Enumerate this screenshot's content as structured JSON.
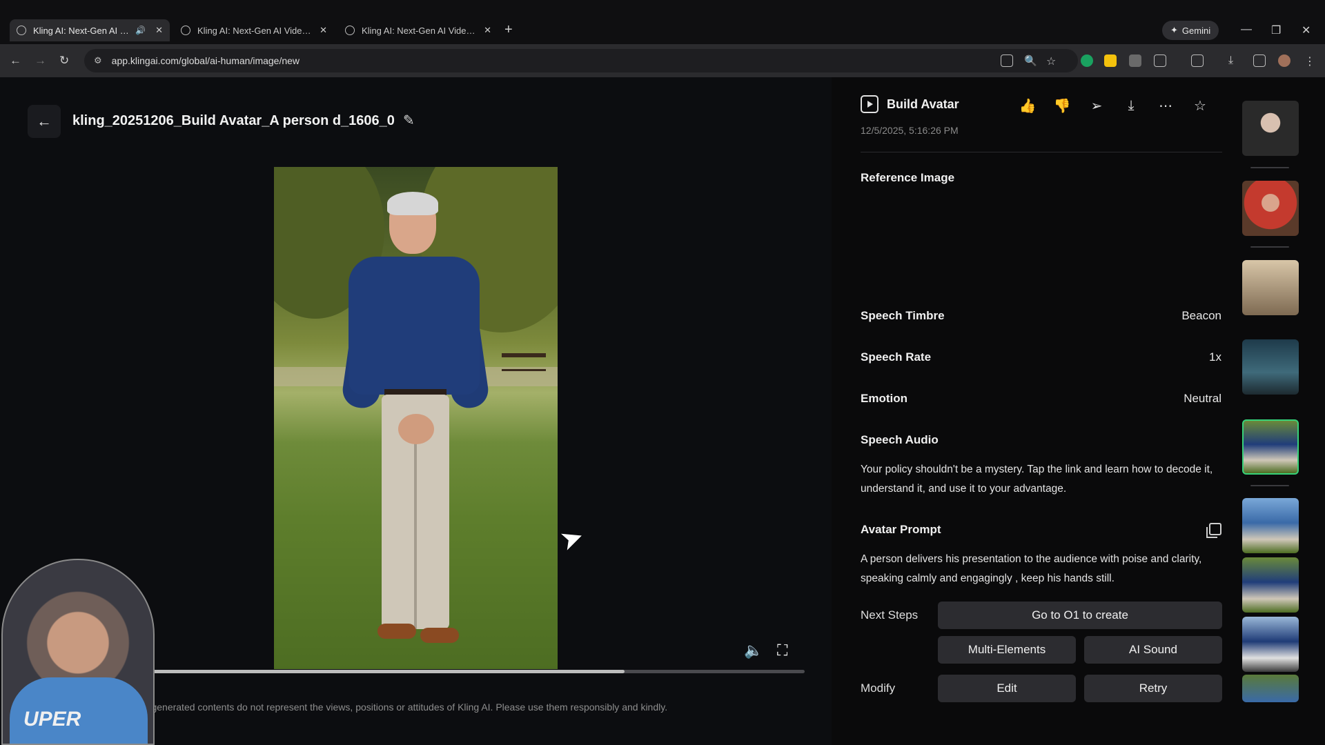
{
  "browser": {
    "tabs": [
      {
        "title": "Kling AI: Next-Gen AI Video",
        "active": true,
        "audio": true
      },
      {
        "title": "Kling AI: Next-Gen AI Video & /",
        "active": false,
        "audio": false
      },
      {
        "title": "Kling AI: Next-Gen AI Video & /",
        "active": false,
        "audio": false
      }
    ],
    "gemini_label": "Gemini",
    "url": "app.klingai.com/global/ai-human/image/new"
  },
  "header": {
    "title": "kling_20251206_Build Avatar_A person d_1606_0"
  },
  "player": {
    "progress": 0.73,
    "disclaimer": "he generated contents do not represent the views, positions or attitudes of Kling AI. Please use them responsibly and kindly."
  },
  "webcam": {
    "shirt_text": "UPER"
  },
  "panel": {
    "title": "Build Avatar",
    "date": "12/5/2025, 5:16:26 PM",
    "reference_label": "Reference Image",
    "speech_timbre_label": "Speech Timbre",
    "speech_timbre_value": "Beacon",
    "speech_rate_label": "Speech Rate",
    "speech_rate_value": "1x",
    "emotion_label": "Emotion",
    "emotion_value": "Neutral",
    "speech_audio_label": "Speech Audio",
    "speech_audio_text": "Your policy shouldn't be a mystery. Tap the link and learn how to decode it, understand it, and use it to your advantage.",
    "avatar_prompt_label": "Avatar Prompt",
    "avatar_prompt_text": "A person delivers his presentation to the audience with poise and clarity, speaking calmly and engagingly , keep his hands still.",
    "next_steps_label": "Next Steps",
    "go_o1_label": "Go to O1 to create",
    "multi_elements_label": "Multi-Elements",
    "ai_sound_label": "AI Sound",
    "modify_label": "Modify",
    "edit_label": "Edit",
    "retry_label": "Retry"
  },
  "colors": {
    "accent_selected": "#37d37a",
    "button_bg": "#2c2c30",
    "panel_bg": "#0a0a0b"
  }
}
